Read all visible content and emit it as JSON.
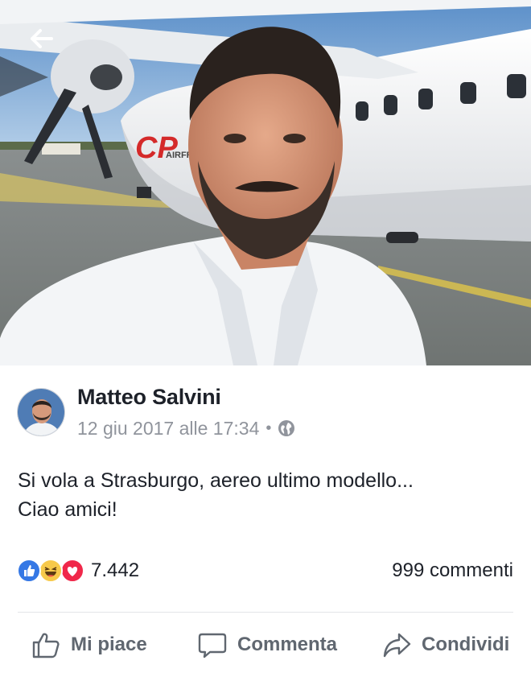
{
  "post": {
    "author": "Matteo Salvini",
    "date": "12 giu 2017 alle 17:34",
    "separator": "•",
    "privacy_icon": "globe-icon",
    "text_lines": [
      "Si vola a Strasburgo, aereo ultimo modello...",
      "Ciao amici!"
    ],
    "photo_text": "AIRFR"
  },
  "reactions": {
    "icons": [
      "like-icon",
      "haha-icon",
      "love-icon"
    ],
    "count": "7.442",
    "comments": "999 commenti",
    "colors": {
      "like": "#3578e5",
      "haha": "#f7c94b",
      "love": "#f0284a"
    }
  },
  "actions": {
    "like_label": "Mi piace",
    "comment_label": "Commenta",
    "share_label": "Condividi"
  },
  "colors": {
    "text": "#1d2129",
    "secondary_text": "#90949c",
    "action_text": "#606770"
  }
}
